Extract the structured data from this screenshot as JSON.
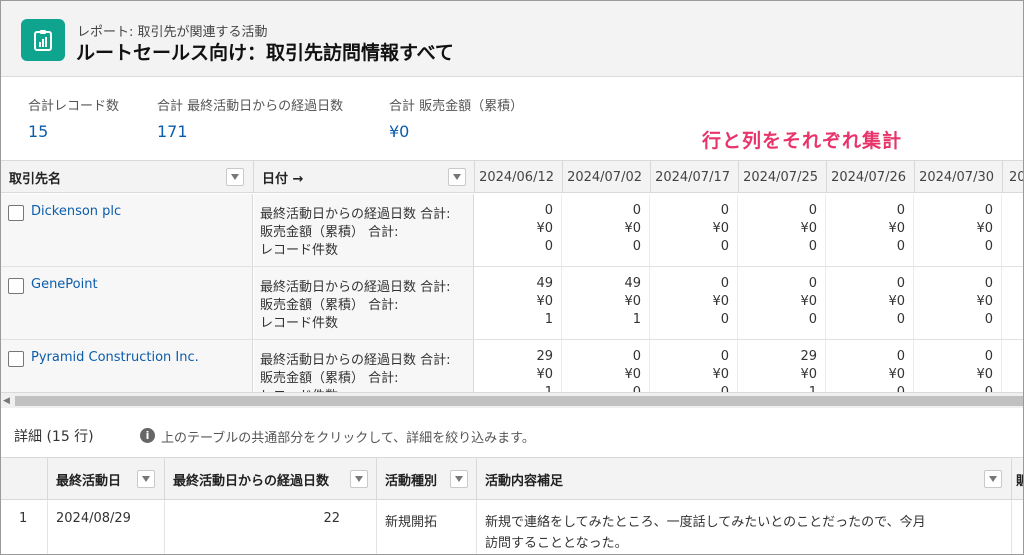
{
  "header": {
    "subtitle": "レポート: 取引先が関連する活動",
    "title": "ルートセールス向け：取引先訪問情報すべて"
  },
  "summary": [
    {
      "label": "合計レコード数",
      "value": "15"
    },
    {
      "label": "合計 最終活動日からの経過日数",
      "value": "171"
    },
    {
      "label": "合計 販売金額（累積）",
      "value": "¥0"
    }
  ],
  "annotation": "行と列をそれぞれ集計",
  "matrix": {
    "row_grouping_label": "取引先名",
    "column_grouping_label": "日付 →",
    "date_columns": [
      "2024/06/12",
      "2024/07/02",
      "2024/07/17",
      "2024/07/25",
      "2024/07/26",
      "2024/07/30",
      "20"
    ],
    "metric_labels": [
      "最終活動日からの経過日数 合計:",
      "販売金額（累積） 合計:",
      "レコード件数"
    ],
    "rows": [
      {
        "account": "Dickenson plc",
        "cells": [
          [
            "0",
            "¥0",
            "0"
          ],
          [
            "0",
            "¥0",
            "0"
          ],
          [
            "0",
            "¥0",
            "0"
          ],
          [
            "0",
            "¥0",
            "0"
          ],
          [
            "0",
            "¥0",
            "0"
          ],
          [
            "0",
            "¥0",
            "0"
          ]
        ]
      },
      {
        "account": "GenePoint",
        "cells": [
          [
            "49",
            "¥0",
            "1"
          ],
          [
            "49",
            "¥0",
            "1"
          ],
          [
            "0",
            "¥0",
            "0"
          ],
          [
            "0",
            "¥0",
            "0"
          ],
          [
            "0",
            "¥0",
            "0"
          ],
          [
            "0",
            "¥0",
            "0"
          ]
        ]
      },
      {
        "account": "Pyramid Construction Inc.",
        "cells": [
          [
            "29",
            "¥0",
            "1"
          ],
          [
            "0",
            "¥0",
            "0"
          ],
          [
            "0",
            "¥0",
            "0"
          ],
          [
            "29",
            "¥0",
            "1"
          ],
          [
            "0",
            "¥0",
            "0"
          ],
          [
            "0",
            "¥0",
            "0"
          ]
        ]
      }
    ]
  },
  "details": {
    "title": "詳細 (15 行)",
    "hint": "上のテーブルの共通部分をクリックして、詳細を絞り込みます。",
    "columns": [
      "最終活動日",
      "最終活動日からの経過日数",
      "活動種別",
      "活動内容補足",
      "販"
    ],
    "rows": [
      {
        "index": "1",
        "last_activity_date": "2024/08/29",
        "days_since": "22",
        "activity_type": "新規開拓",
        "note_line1": "新規で連絡をしてみたところ、一度話してみたいとのことだったので、今月",
        "note_line2": "訪問することとなった。"
      }
    ]
  },
  "colors": {
    "accent_icon": "#0fa48e",
    "link": "#0b5cab",
    "annotation": "#e8346b"
  }
}
